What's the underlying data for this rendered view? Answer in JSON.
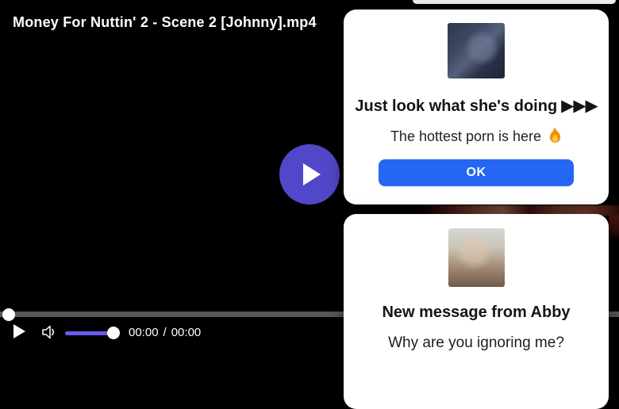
{
  "video_player": {
    "title": "Money For Nuttin' 2 - Scene 2 [Johnny].mp4",
    "controls": {
      "current_time": "00:00",
      "separator": "/",
      "duration": "00:00",
      "progress_percent": 0,
      "volume_percent": 100
    },
    "colors": {
      "play_button": "#5347c9",
      "volume_fill": "#6a5cf0",
      "progress_track": "#58585a",
      "background": "#000000"
    },
    "icons": [
      "play-icon",
      "volume-icon"
    ]
  },
  "popups": [
    {
      "heading": "Just look what she's doing",
      "heading_arrows": "▶▶▶",
      "subtext": "The hottest porn is here",
      "subtext_icon": "fire-icon",
      "button_label": "OK",
      "button_color": "#2567f2",
      "thumbnail_icon": "webcam-thumbnail"
    },
    {
      "heading": "New message from Abby",
      "subtext": "Why are you ignoring me?",
      "thumbnail_icon": "selfie-thumbnail"
    }
  ]
}
